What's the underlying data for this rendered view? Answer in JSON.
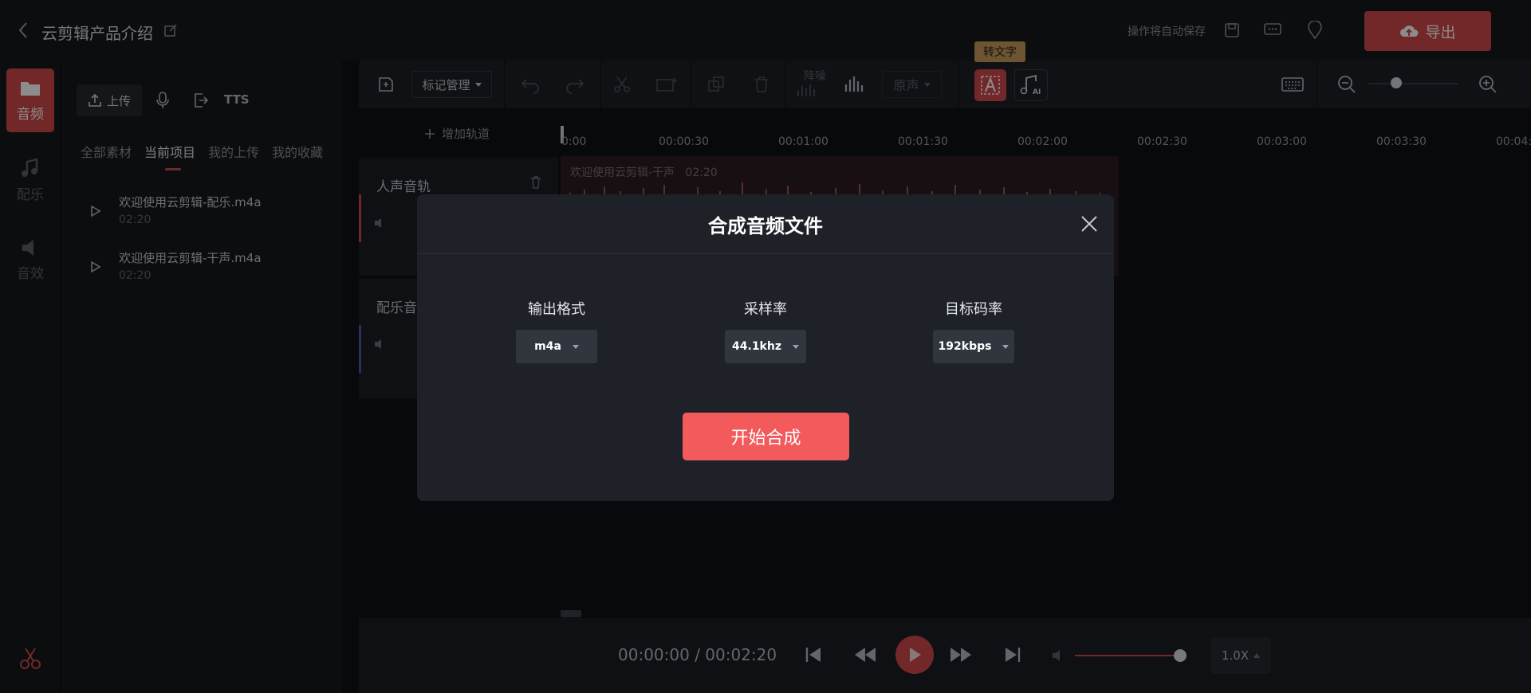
{
  "header": {
    "project_title": "云剪辑产品介绍",
    "autosave_text": "操作将自动保存",
    "export_label": "导出"
  },
  "rail": {
    "items": [
      {
        "label": "音频",
        "icon": "folder-icon",
        "active": true
      },
      {
        "label": "配乐",
        "icon": "music-note-icon",
        "active": false
      },
      {
        "label": "音效",
        "icon": "speaker-icon",
        "active": false
      }
    ]
  },
  "media": {
    "upload_label": "上传",
    "tts_label": "TTS",
    "tabs": [
      "全部素材",
      "当前项目",
      "我的上传",
      "我的收藏"
    ],
    "active_tab": "当前项目",
    "files": [
      {
        "name": "欢迎使用云剪辑-配乐.m4a",
        "duration": "02:20"
      },
      {
        "name": "欢迎使用云剪辑-干声.m4a",
        "duration": "02:20"
      }
    ]
  },
  "toolbar": {
    "tag_manage_label": "标记管理",
    "denoise_label": "降噪",
    "original_voice_label": "原声",
    "to_text_tooltip": "转文字"
  },
  "timeline": {
    "add_track_label": "增加轨道",
    "ticks": [
      "0:00",
      "00:00:30",
      "00:01:00",
      "00:01:30",
      "00:02:00",
      "00:02:30",
      "00:03:00",
      "00:03:30",
      "00:04:"
    ],
    "tracks": [
      {
        "name": "人声音轨"
      },
      {
        "name": "配乐音"
      }
    ],
    "clip_title": "欢迎使用云剪辑-干声",
    "clip_duration": "02:20"
  },
  "modal": {
    "title": "合成音频文件",
    "fields": [
      {
        "label": "输出格式",
        "value": "m4a"
      },
      {
        "label": "采样率",
        "value": "44.1khz"
      },
      {
        "label": "目标码率",
        "value": "192kbps"
      }
    ],
    "start_label": "开始合成"
  },
  "player": {
    "current_time": "00:00:00",
    "total_time": "00:02:20",
    "separator": "/",
    "speed": "1.0X",
    "volume_fraction": 0.93
  },
  "colors": {
    "accent": "#cf4a4c",
    "start_button": "#f25a5c",
    "background": "#0f1115"
  }
}
